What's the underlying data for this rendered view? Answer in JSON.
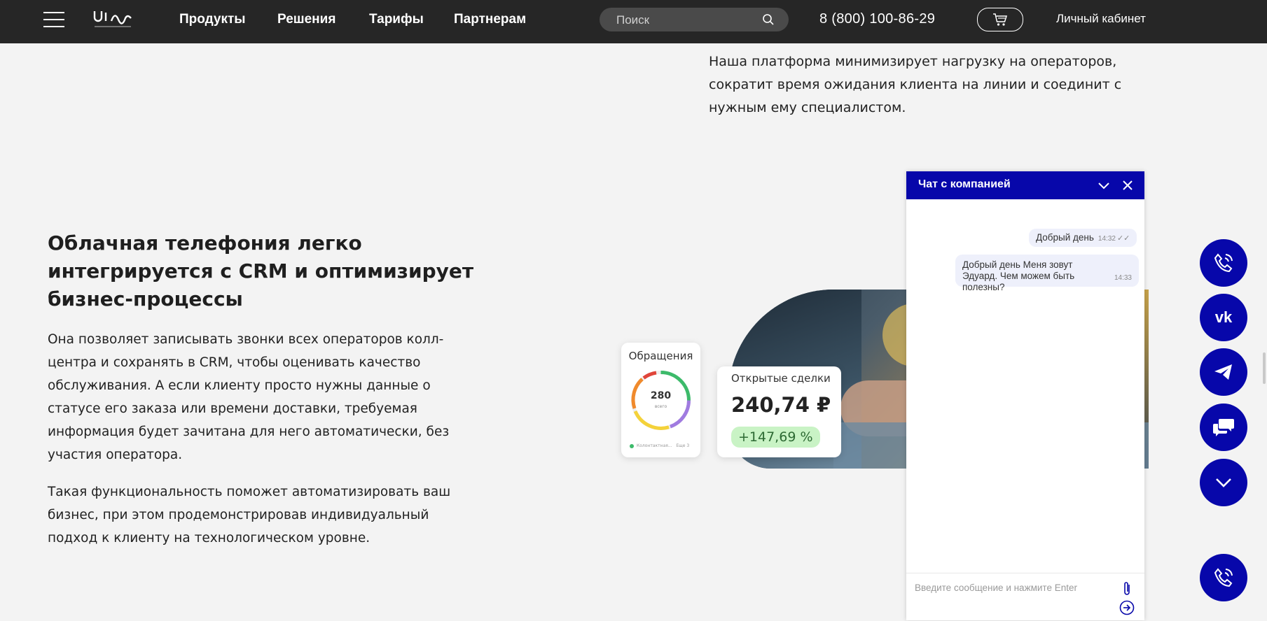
{
  "header": {
    "nav": [
      "Продукты",
      "Решения",
      "Тарифы",
      "Партнерам"
    ],
    "search_placeholder": "Поиск",
    "phone": "8 (800) 100-86-29",
    "account": "Личный кабинет",
    "logo_icon": "uis-logo",
    "menu_icon": "hamburger-menu-icon",
    "cart_icon": "cart-icon"
  },
  "content": {
    "top_text": "Наша платформа минимизирует нагрузку на операторов, сократит время ожидания клиента на линии и соединит с нужным ему специалистом.",
    "heading": "Облачная телефония легко интегрируется с CRM и оптимизирует бизнес-процессы",
    "paragraph1": "Она позволяет записывать звонки всех операторов колл-центра и сохранять в CRM, чтобы оценивать качество обслуживания. А если клиенту просто нужны данные о статусе его заказа или времени доставки, требуемая информация будет зачитана для него автоматически, без участия оператора.",
    "paragraph2": "Такая функциональность поможет автоматизировать ваш бизнес, при этом продемонстрировав индивидуальный подход к клиенту на технологическом уровне."
  },
  "widgets": {
    "requests_title": "Обращения",
    "requests_value": "280",
    "requests_sub": "всего",
    "requests_legend_1": "Колонтактная...",
    "requests_legend_2": "Еще 3",
    "deals_title": "Открытые сделки",
    "deals_value": "240,74 ₽",
    "deals_change": "+147,69 %"
  },
  "chat": {
    "title": "Чат с компанией",
    "messages": [
      {
        "text": "Добрый день",
        "time": "14:32",
        "status": "✓✓"
      },
      {
        "text": "Добрый день Меня зовут Эдуард. Чем можем быть полезны?",
        "time": "14:33"
      }
    ],
    "input_placeholder": "Введите сообщение и нажмите Enter"
  },
  "floating_buttons": {
    "vk_label": "vk",
    "icons": [
      "phone-icon",
      "vk-icon",
      "telegram-icon",
      "chat-icon",
      "chevron-down-icon",
      "phone-icon"
    ]
  },
  "colors": {
    "header_bg": "#262626",
    "accent": "#0707aa",
    "badge_bg": "#c9f3c5",
    "page_bg": "#f3f3f3"
  }
}
